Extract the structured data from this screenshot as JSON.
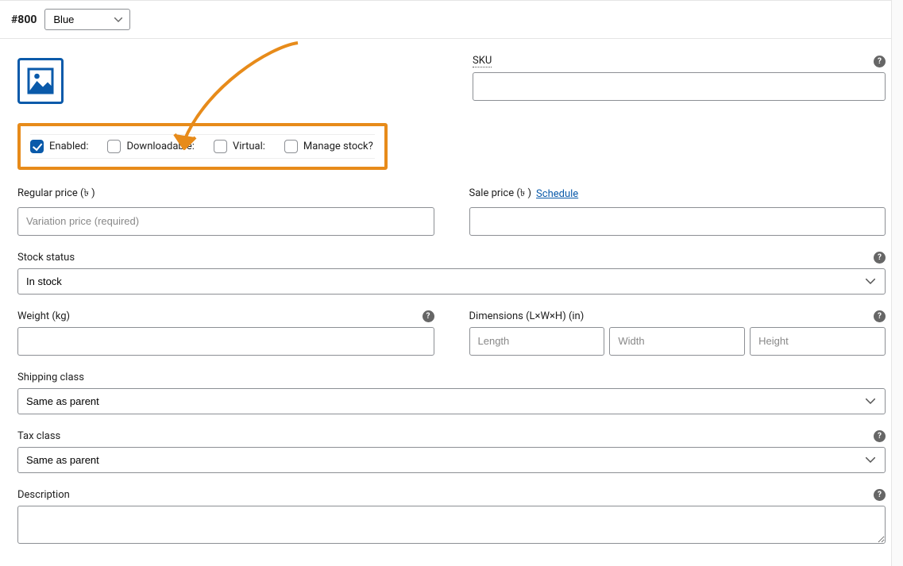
{
  "header": {
    "variation_id": "#800",
    "attribute_selected": "Blue"
  },
  "checkboxes": {
    "enabled_label": "Enabled:",
    "enabled_checked": true,
    "downloadable_label": "Downloadable:",
    "downloadable_checked": false,
    "virtual_label": "Virtual:",
    "virtual_checked": false,
    "manage_stock_label": "Manage stock?",
    "manage_stock_checked": false
  },
  "sku": {
    "label": "SKU",
    "value": ""
  },
  "regular_price": {
    "label": "Regular price (৳ )",
    "placeholder": "Variation price (required)",
    "value": ""
  },
  "sale_price": {
    "label": "Sale price (৳ )",
    "schedule_link": "Schedule",
    "value": ""
  },
  "stock_status": {
    "label": "Stock status",
    "value": "In stock"
  },
  "weight": {
    "label": "Weight (kg)",
    "value": ""
  },
  "dimensions": {
    "label": "Dimensions (L×W×H) (in)",
    "length_placeholder": "Length",
    "width_placeholder": "Width",
    "height_placeholder": "Height"
  },
  "shipping_class": {
    "label": "Shipping class",
    "value": "Same as parent"
  },
  "tax_class": {
    "label": "Tax class",
    "value": "Same as parent"
  },
  "description": {
    "label": "Description",
    "value": ""
  },
  "annotation_color": "#e78b1a"
}
